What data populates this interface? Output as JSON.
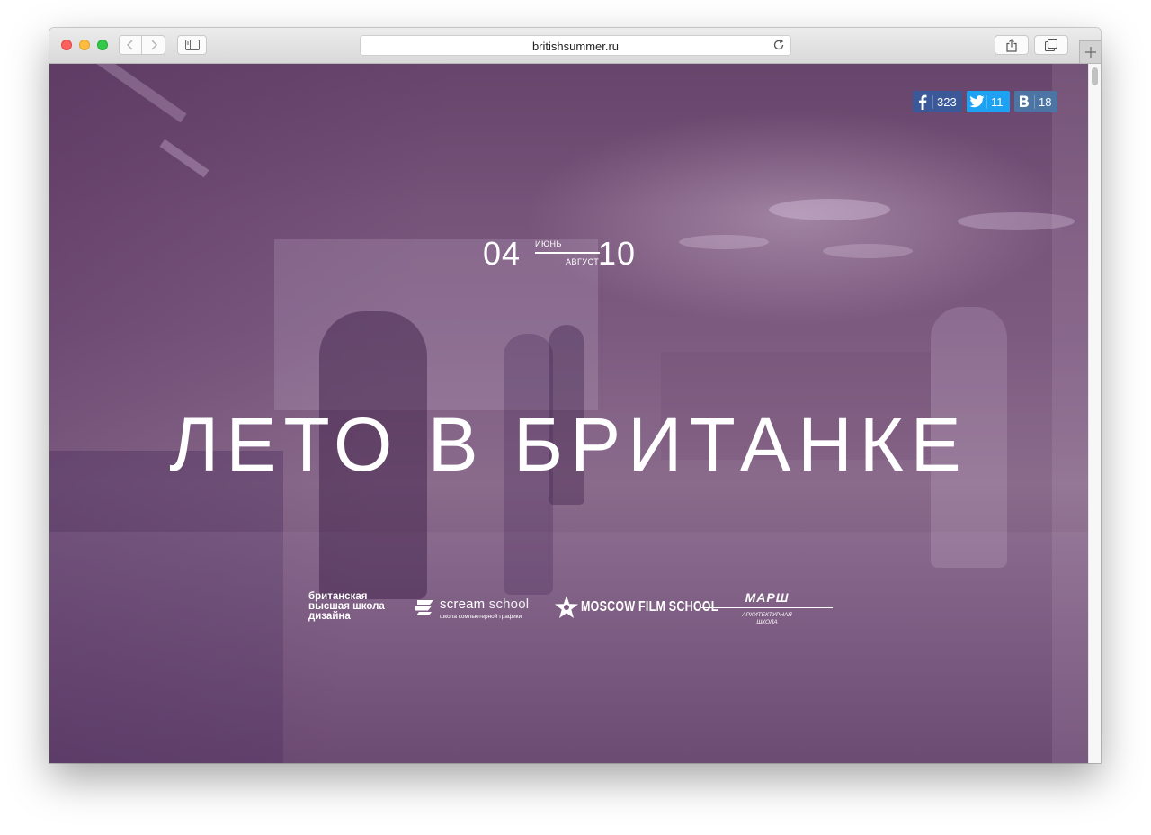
{
  "browser": {
    "url": "britishsummer.ru"
  },
  "social": {
    "facebook": {
      "icon": "facebook-icon",
      "count": "323",
      "color": "#3b5998"
    },
    "twitter": {
      "icon": "twitter-icon",
      "count": "11",
      "color": "#1da1f2"
    },
    "vk": {
      "icon": "vk-icon",
      "count": "18",
      "color": "#4c75a3"
    }
  },
  "dates": {
    "start_day": "04",
    "start_month": "ИЮНЬ",
    "end_month": "АВГУСТ",
    "end_day": "10"
  },
  "headline": "ЛЕТО В БРИТАНКЕ",
  "partners": {
    "bhsad": [
      "британская",
      "высшая школа",
      "дизайна"
    ],
    "scream": {
      "name_bold": "scream",
      "name_light": " school",
      "subtitle": "школа компьютерной графики"
    },
    "mfs": {
      "name": "MOSCOW FILM SCHOOL"
    },
    "marsh": {
      "name": "МАРШ",
      "subtitle": [
        "АРХИТЕКТУРНАЯ",
        "ШКОЛА"
      ]
    }
  },
  "colors": {
    "overlay": "#7c5a80"
  }
}
